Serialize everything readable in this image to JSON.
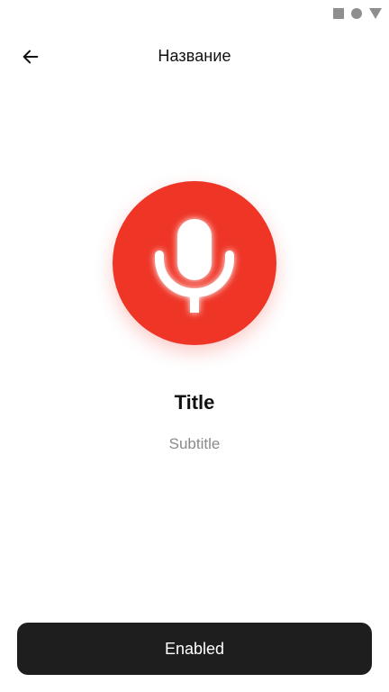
{
  "status_bar": {
    "icons": [
      "stop-square-icon",
      "circle-icon",
      "triangle-down-icon"
    ],
    "icon_color": "#8e8e8e"
  },
  "app_bar": {
    "back_icon": "arrow-left-icon",
    "title": "Название"
  },
  "hero": {
    "icon": "microphone-icon",
    "circle_color": "#ee3526",
    "icon_color": "#ffffff"
  },
  "content": {
    "title": "Title",
    "subtitle": "Subtitle"
  },
  "primary_button": {
    "label": "Enabled",
    "background": "#1e1e1f"
  }
}
